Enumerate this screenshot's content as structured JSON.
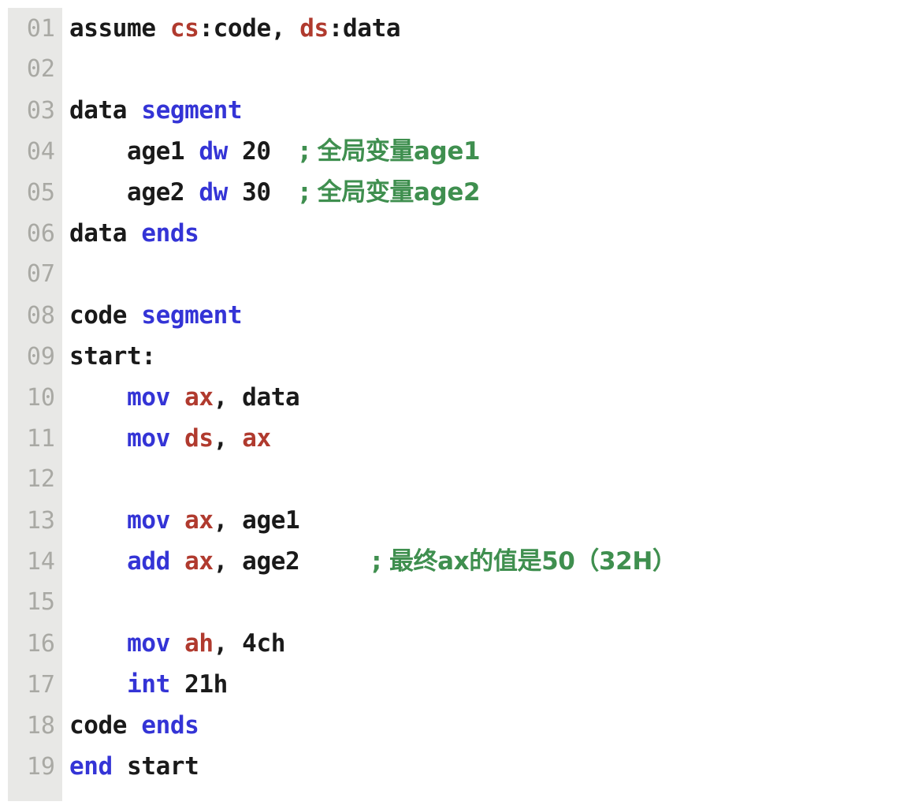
{
  "editor": {
    "kind": "source-code-viewer",
    "language": "x86-assembly",
    "background": "#ffffff",
    "gutter_background": "#e8e8e6",
    "line_number_color": "#a9a9a4",
    "colors": {
      "plain": "#1a1a1a",
      "keyword": "#3434d6",
      "register": "#b03a2e",
      "comment": "#3f8f4f"
    },
    "lines": [
      {
        "no": "01",
        "segments": [
          {
            "t": "assume ",
            "c": "plain"
          },
          {
            "t": "cs",
            "c": "register"
          },
          {
            "t": ":code, ",
            "c": "plain"
          },
          {
            "t": "ds",
            "c": "register"
          },
          {
            "t": ":data",
            "c": "plain"
          }
        ]
      },
      {
        "no": "02",
        "segments": []
      },
      {
        "no": "03",
        "segments": [
          {
            "t": "data ",
            "c": "plain"
          },
          {
            "t": "segment",
            "c": "keyword"
          }
        ]
      },
      {
        "no": "04",
        "segments": [
          {
            "t": "    age1 ",
            "c": "plain"
          },
          {
            "t": "dw",
            "c": "keyword"
          },
          {
            "t": " 20  ",
            "c": "plain"
          },
          {
            "t": "; 全局变量age1",
            "c": "comment"
          }
        ]
      },
      {
        "no": "05",
        "segments": [
          {
            "t": "    age2 ",
            "c": "plain"
          },
          {
            "t": "dw",
            "c": "keyword"
          },
          {
            "t": " 30  ",
            "c": "plain"
          },
          {
            "t": "; 全局变量age2",
            "c": "comment"
          }
        ]
      },
      {
        "no": "06",
        "segments": [
          {
            "t": "data ",
            "c": "plain"
          },
          {
            "t": "ends",
            "c": "keyword"
          }
        ]
      },
      {
        "no": "07",
        "segments": []
      },
      {
        "no": "08",
        "segments": [
          {
            "t": "code ",
            "c": "plain"
          },
          {
            "t": "segment",
            "c": "keyword"
          }
        ]
      },
      {
        "no": "09",
        "segments": [
          {
            "t": "start:",
            "c": "plain"
          }
        ]
      },
      {
        "no": "10",
        "segments": [
          {
            "t": "    ",
            "c": "plain"
          },
          {
            "t": "mov",
            "c": "keyword"
          },
          {
            "t": " ",
            "c": "plain"
          },
          {
            "t": "ax",
            "c": "register"
          },
          {
            "t": ", data",
            "c": "plain"
          }
        ]
      },
      {
        "no": "11",
        "segments": [
          {
            "t": "    ",
            "c": "plain"
          },
          {
            "t": "mov",
            "c": "keyword"
          },
          {
            "t": " ",
            "c": "plain"
          },
          {
            "t": "ds",
            "c": "register"
          },
          {
            "t": ", ",
            "c": "plain"
          },
          {
            "t": "ax",
            "c": "register"
          }
        ]
      },
      {
        "no": "12",
        "segments": []
      },
      {
        "no": "13",
        "segments": [
          {
            "t": "    ",
            "c": "plain"
          },
          {
            "t": "mov",
            "c": "keyword"
          },
          {
            "t": " ",
            "c": "plain"
          },
          {
            "t": "ax",
            "c": "register"
          },
          {
            "t": ", age1",
            "c": "plain"
          }
        ]
      },
      {
        "no": "14",
        "segments": [
          {
            "t": "    ",
            "c": "plain"
          },
          {
            "t": "add",
            "c": "keyword"
          },
          {
            "t": " ",
            "c": "plain"
          },
          {
            "t": "ax",
            "c": "register"
          },
          {
            "t": ", age2     ",
            "c": "plain"
          },
          {
            "t": "; 最终ax的值是50（32H）",
            "c": "comment"
          }
        ]
      },
      {
        "no": "15",
        "segments": []
      },
      {
        "no": "16",
        "segments": [
          {
            "t": "    ",
            "c": "plain"
          },
          {
            "t": "mov",
            "c": "keyword"
          },
          {
            "t": " ",
            "c": "plain"
          },
          {
            "t": "ah",
            "c": "register"
          },
          {
            "t": ", 4ch",
            "c": "plain"
          }
        ]
      },
      {
        "no": "17",
        "segments": [
          {
            "t": "    ",
            "c": "plain"
          },
          {
            "t": "int",
            "c": "keyword"
          },
          {
            "t": " 21h",
            "c": "plain"
          }
        ]
      },
      {
        "no": "18",
        "segments": [
          {
            "t": "code ",
            "c": "plain"
          },
          {
            "t": "ends",
            "c": "keyword"
          }
        ]
      },
      {
        "no": "19",
        "segments": [
          {
            "t": "end",
            "c": "keyword"
          },
          {
            "t": " start",
            "c": "plain"
          }
        ]
      }
    ]
  }
}
